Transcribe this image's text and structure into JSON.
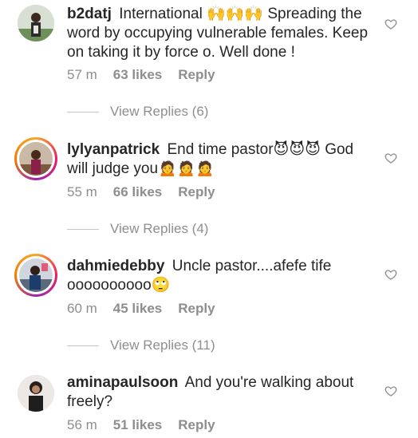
{
  "comments": [
    {
      "username": "b2datj",
      "text": " International 🙌🙌🙌 Spreading the word by occupying vulnerable females. Keep on taking it by force o. Well done !",
      "time": "57 m",
      "likes": "63 likes",
      "reply": "Reply",
      "view_replies": "View Replies (6)"
    },
    {
      "username": "lylyanpatrick",
      "text": " End time pastor😈😈😈 God will judge you🙍🙍🙍",
      "time": "55 m",
      "likes": "66 likes",
      "reply": "Reply",
      "view_replies": "View Replies (4)"
    },
    {
      "username": "dahmiedebby",
      "text": " Uncle pastor....afefe tife oooooooooo🙄",
      "time": "60 m",
      "likes": "45 likes",
      "reply": "Reply",
      "view_replies": "View Replies (11)"
    },
    {
      "username": "aminapaulsoon",
      "text": " And you're walking about freely?",
      "time": "56 m",
      "likes": "51 likes",
      "reply": "Reply"
    }
  ],
  "icons": {
    "like": "heart-outline-icon"
  },
  "colors": {
    "text": "#262626",
    "secondary": "#8e8e8e",
    "divider": "#c7c7c7"
  }
}
